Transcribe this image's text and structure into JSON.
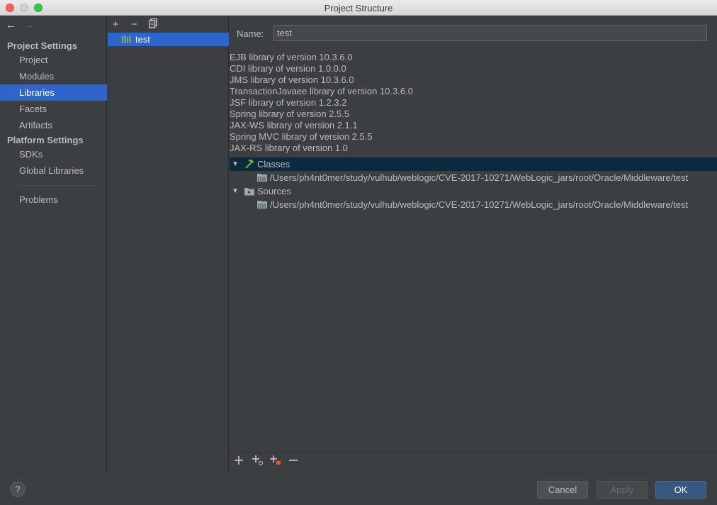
{
  "window": {
    "title": "Project Structure"
  },
  "sidebar": {
    "project_settings_heading": "Project Settings",
    "project_items": [
      "Project",
      "Modules",
      "Libraries",
      "Facets",
      "Artifacts"
    ],
    "platform_settings_heading": "Platform Settings",
    "platform_items": [
      "SDKs",
      "Global Libraries"
    ],
    "problems": "Problems",
    "selected": "Libraries"
  },
  "libraries": {
    "toolbar": {
      "add": "+",
      "remove": "−"
    },
    "items": [
      "test"
    ]
  },
  "detail": {
    "name_label": "Name:",
    "name_value": "test",
    "info_lines": [
      "EJB library of version 10.3.6.0",
      "CDI library of version 1.0.0.0",
      "JMS library of version 10.3.6.0",
      "TransactionJavaee library of version 10.3.6.0",
      "JSF library of version 1.2.3.2",
      "Spring library of version 2.5.5",
      "JAX-WS library of version 2.1.1",
      "Spring MVC library of version 2.5.5",
      "JAX-RS library of version 1.0"
    ],
    "tree": {
      "classes_label": "Classes",
      "classes_path": "/Users/ph4nt0mer/study/vulhub/weblogic/CVE-2017-10271/WebLogic_jars/root/Oracle/Middleware/test",
      "sources_label": "Sources",
      "sources_path": "/Users/ph4nt0mer/study/vulhub/weblogic/CVE-2017-10271/WebLogic_jars/root/Oracle/Middleware/test"
    }
  },
  "footer": {
    "help": "?",
    "cancel": "Cancel",
    "apply": "Apply",
    "ok": "OK"
  },
  "colors": {
    "selection": "#2f65ca",
    "tree_selection": "#0d293e",
    "background": "#3c3f41",
    "ok_button": "#365880"
  }
}
